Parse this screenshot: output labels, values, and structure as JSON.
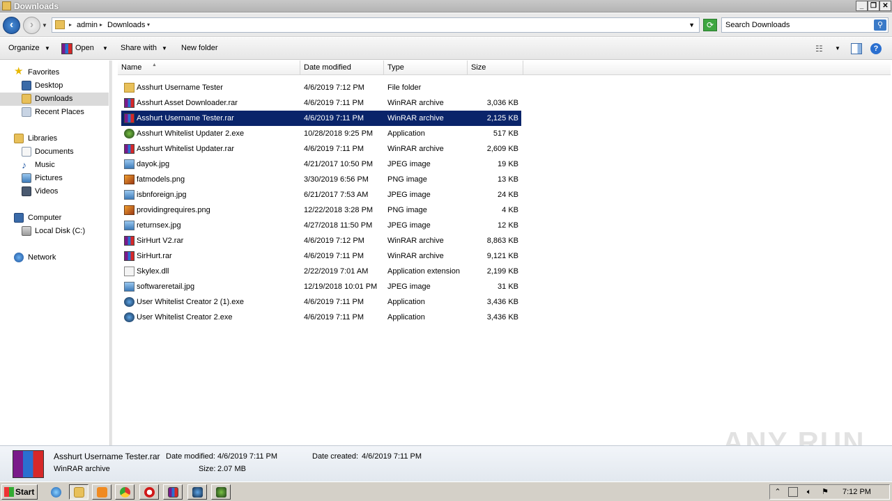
{
  "window": {
    "title": "Downloads"
  },
  "address": {
    "crumbs": [
      "admin",
      "Downloads"
    ],
    "search_placeholder": "Search Downloads"
  },
  "toolbar": {
    "organize": "Organize",
    "open": "Open",
    "share_with": "Share with",
    "new_folder": "New folder"
  },
  "sidebar": {
    "favorites": "Favorites",
    "desktop": "Desktop",
    "downloads": "Downloads",
    "recent_places": "Recent Places",
    "libraries": "Libraries",
    "documents": "Documents",
    "music": "Music",
    "pictures": "Pictures",
    "videos": "Videos",
    "computer": "Computer",
    "local_disk": "Local Disk (C:)",
    "network": "Network"
  },
  "columns": {
    "name": "Name",
    "date": "Date modified",
    "type": "Type",
    "size": "Size"
  },
  "files": [
    {
      "name": "Asshurt Username Tester",
      "date": "4/6/2019 7:12 PM",
      "type": "File folder",
      "size": "",
      "icon": "folder-icon"
    },
    {
      "name": "Asshurt Asset Downloader.rar",
      "date": "4/6/2019 7:11 PM",
      "type": "WinRAR archive",
      "size": "3,036 KB",
      "icon": "winrar-icon"
    },
    {
      "name": "Asshurt Username Tester.rar",
      "date": "4/6/2019 7:11 PM",
      "type": "WinRAR archive",
      "size": "2,125 KB",
      "icon": "winrar-icon"
    },
    {
      "name": "Asshurt Whitelist Updater 2.exe",
      "date": "10/28/2018 9:25 PM",
      "type": "Application",
      "size": "517 KB",
      "icon": "app-icon"
    },
    {
      "name": "Asshurt Whitelist Updater.rar",
      "date": "4/6/2019 7:11 PM",
      "type": "WinRAR archive",
      "size": "2,609 KB",
      "icon": "winrar-icon"
    },
    {
      "name": "dayok.jpg",
      "date": "4/21/2017 10:50 PM",
      "type": "JPEG image",
      "size": "19 KB",
      "icon": "jpeg-icon"
    },
    {
      "name": "fatmodels.png",
      "date": "3/30/2019 6:56 PM",
      "type": "PNG image",
      "size": "13 KB",
      "icon": "png-icon"
    },
    {
      "name": "isbnforeign.jpg",
      "date": "6/21/2017 7:53 AM",
      "type": "JPEG image",
      "size": "24 KB",
      "icon": "jpeg-icon"
    },
    {
      "name": "providingrequires.png",
      "date": "12/22/2018 3:28 PM",
      "type": "PNG image",
      "size": "4 KB",
      "icon": "png-icon"
    },
    {
      "name": "returnsex.jpg",
      "date": "4/27/2018 11:50 PM",
      "type": "JPEG image",
      "size": "12 KB",
      "icon": "jpeg-icon"
    },
    {
      "name": "SirHurt V2.rar",
      "date": "4/6/2019 7:12 PM",
      "type": "WinRAR archive",
      "size": "8,863 KB",
      "icon": "winrar-icon"
    },
    {
      "name": "SirHurt.rar",
      "date": "4/6/2019 7:11 PM",
      "type": "WinRAR archive",
      "size": "9,121 KB",
      "icon": "winrar-icon"
    },
    {
      "name": "Skylex.dll",
      "date": "2/22/2019 7:01 AM",
      "type": "Application extension",
      "size": "2,199 KB",
      "icon": "dll-icon"
    },
    {
      "name": "softwareretail.jpg",
      "date": "12/19/2018 10:01 PM",
      "type": "JPEG image",
      "size": "31 KB",
      "icon": "jpeg-icon"
    },
    {
      "name": "User Whitelist Creator 2 (1).exe",
      "date": "4/6/2019 7:11 PM",
      "type": "Application",
      "size": "3,436 KB",
      "icon": "app-blue-icon"
    },
    {
      "name": "User Whitelist Creator 2.exe",
      "date": "4/6/2019 7:11 PM",
      "type": "Application",
      "size": "3,436 KB",
      "icon": "app-blue-icon"
    }
  ],
  "details": {
    "name": "Asshurt Username Tester.rar",
    "type": "WinRAR archive",
    "modified_label": "Date modified:",
    "modified": "4/6/2019 7:11 PM",
    "created_label": "Date created:",
    "created": "4/6/2019 7:11 PM",
    "size_label": "Size:",
    "size": "2.07 MB"
  },
  "watermark": "ANY RUN",
  "taskbar": {
    "start": "Start",
    "clock": "7:12 PM"
  }
}
